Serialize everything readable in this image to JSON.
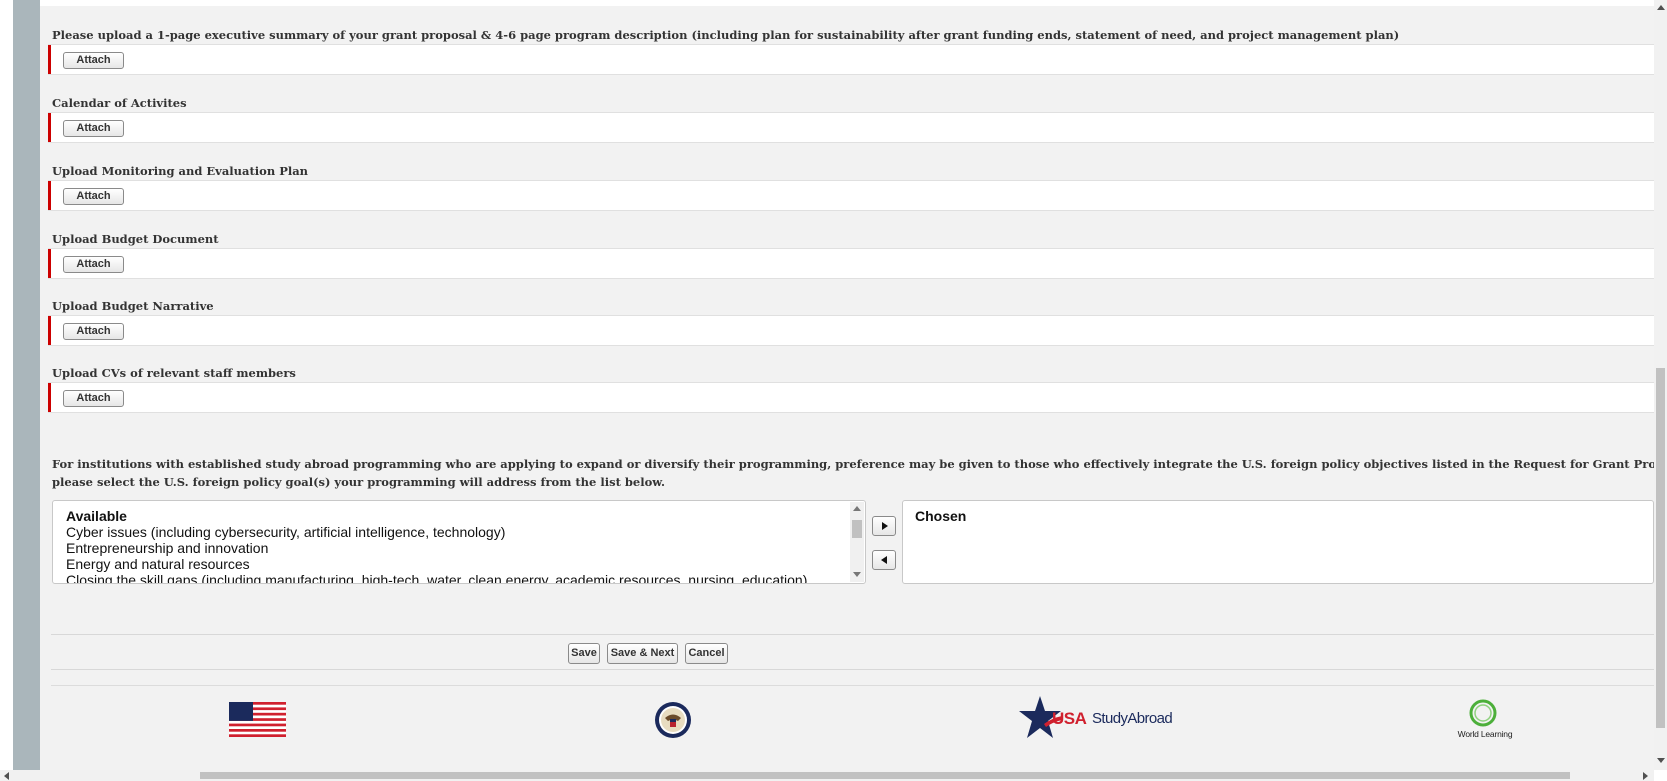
{
  "questions": [
    {
      "label": "Please upload a 1-page executive summary of your grant proposal & 4-6 page program description (including plan for sustainability after grant funding ends, statement of need, and project management plan)",
      "button": "Attach"
    },
    {
      "label": "Calendar of Activites",
      "button": "Attach"
    },
    {
      "label": "Upload Monitoring and Evaluation Plan",
      "button": "Attach"
    },
    {
      "label": "Upload Budget Document",
      "button": "Attach"
    },
    {
      "label": "Upload Budget Narrative",
      "button": "Attach"
    },
    {
      "label": "Upload CVs of relevant staff members",
      "button": "Attach"
    }
  ],
  "policy": {
    "line1": "For institutions with established study abroad programming who are applying to expand or diversify their programming, preference may be given to those who effectively integrate the U.S. foreign policy objectives listed in the Request for Grant Proposals into their programming. If ap",
    "line2": "please select the U.S. foreign policy goal(s) your programming will address from the list below."
  },
  "picklist": {
    "available_header": "Available",
    "available_options": [
      "Cyber issues (including cybersecurity, artificial intelligence, technology)",
      "Entrepreneurship and innovation",
      "Energy and natural resources",
      "Closing the skill gaps (including manufacturing, high-tech, water, clean energy, academic resources, nursing, education)"
    ],
    "chosen_header": "Chosen",
    "chosen_options": []
  },
  "actions": {
    "save": "Save",
    "save_next": "Save & Next",
    "cancel": "Cancel"
  },
  "footer": {
    "usa_logo_text": "USA",
    "study_abroad_logo_text": "StudyAbroad",
    "world_learning_text": "World Learning"
  },
  "colors": {
    "required_marker": "#cc0000",
    "usa_red": "#d0202e",
    "navy": "#1b2a5c",
    "world_learning_green": "#4caf3a"
  }
}
